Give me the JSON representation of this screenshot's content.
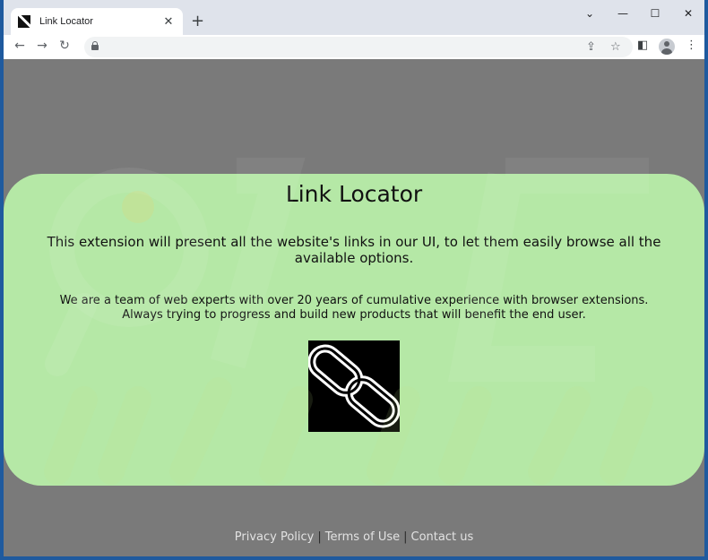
{
  "browser": {
    "tab_title": "Link Locator",
    "tab_close": "✕",
    "new_tab": "+",
    "controls": {
      "dropdown": "⌄",
      "minimize": "—",
      "maximize": "☐",
      "close": "✕"
    }
  },
  "page": {
    "title": "Link Locator",
    "lead": "This extension will present all the website's links in our UI, to let them easily browse all the available options.",
    "body_line1": "We are a team of web experts with over 20 years of cumulative experience with browser extensions.",
    "body_line2": "Always trying to progress and build new products that will benefit the end user.",
    "footer": {
      "privacy": "Privacy Policy",
      "terms": "Terms of Use",
      "contact": "Contact us",
      "separator": "|"
    }
  },
  "colors": {
    "card_bg": "#b5e8a6",
    "page_bg": "#7a7a7a",
    "frame": "#1f5a9e"
  }
}
